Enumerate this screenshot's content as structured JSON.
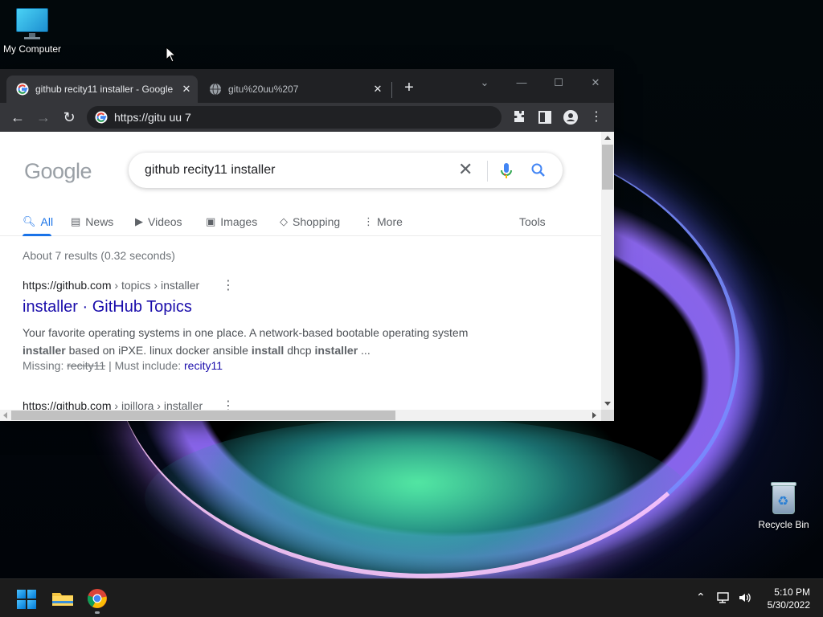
{
  "desktop": {
    "icons": [
      {
        "label": "My Computer",
        "icon": "monitor-icon"
      },
      {
        "label": "Recycle Bin",
        "icon": "recycle-bin-icon"
      }
    ]
  },
  "browser": {
    "tabs": [
      {
        "title": "github recity11 installer - Google",
        "active": true,
        "icon": "google-favicon"
      },
      {
        "title": "gitu%20uu%207",
        "active": false,
        "icon": "globe-icon"
      }
    ],
    "address": "https://gitu uu 7",
    "window_controls": [
      "chevron-down-icon",
      "minimize-icon",
      "maximize-icon",
      "close-icon"
    ]
  },
  "google": {
    "logo": "Google",
    "query": "github recity11 installer",
    "tabs": [
      {
        "label": "All",
        "icon": "search-icon",
        "active": true
      },
      {
        "label": "News",
        "icon": "news-icon",
        "active": false
      },
      {
        "label": "Videos",
        "icon": "video-icon",
        "active": false
      },
      {
        "label": "Images",
        "icon": "image-icon",
        "active": false
      },
      {
        "label": "Shopping",
        "icon": "tag-icon",
        "active": false
      },
      {
        "label": "More",
        "icon": "more-vert-icon",
        "active": false
      }
    ],
    "tools_label": "Tools",
    "stats": "About 7 results (0.32 seconds)",
    "results": [
      {
        "site": "https://github.com",
        "path": " › topics › installer",
        "title": "installer · GitHub Topics",
        "snippet_parts": [
          "Your favorite operating systems in one place. A network-based bootable operating system ",
          "installer",
          " based on iPXE. linux docker ansible ",
          "install",
          " dhcp ",
          "installer",
          " ..."
        ],
        "missing_label": "Missing: ",
        "missing_term": "recity11",
        "must_include_label": " | Must include: ",
        "must_include_term": "recity11"
      },
      {
        "site": "https://github.com",
        "path": " › ipillora › installer"
      }
    ]
  },
  "taskbar": {
    "pinned": [
      "windows-start-icon",
      "file-explorer-icon",
      "chrome-icon"
    ],
    "time": "5:10 PM",
    "date": "5/30/2022"
  }
}
